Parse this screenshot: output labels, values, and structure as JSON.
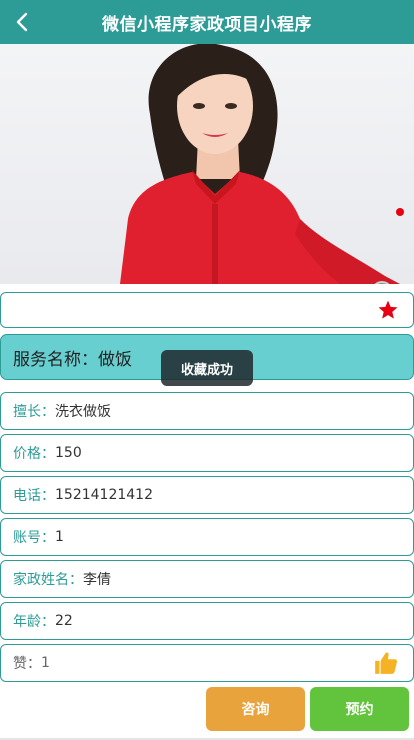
{
  "header": {
    "title": "微信小程序家政项目小程序",
    "back_icon": "chevron-left-icon"
  },
  "service": {
    "name_label": "服务名称：",
    "name_value": "做饭"
  },
  "toast": {
    "text": "收藏成功"
  },
  "details": [
    {
      "label": "擅长：",
      "value": "洗衣做饭"
    },
    {
      "label": "价格：",
      "value": "150"
    },
    {
      "label": "电话：",
      "value": "15214121412"
    },
    {
      "label": "账号：",
      "value": "1"
    },
    {
      "label": "家政姓名：",
      "value": "李倩"
    },
    {
      "label": "年龄：",
      "value": "22"
    },
    {
      "label": "赞：",
      "value": "1"
    }
  ],
  "buttons": {
    "consult": "咨询",
    "book": "预约"
  },
  "colors": {
    "primary": "#2d9c97",
    "service_bg": "#67cfcf",
    "star": "#e60012",
    "thumb": "#f5b323",
    "consult": "#e8a33c",
    "book": "#62c33d"
  },
  "icons": {
    "favorite": "star-icon",
    "like": "thumbs-up-icon"
  }
}
